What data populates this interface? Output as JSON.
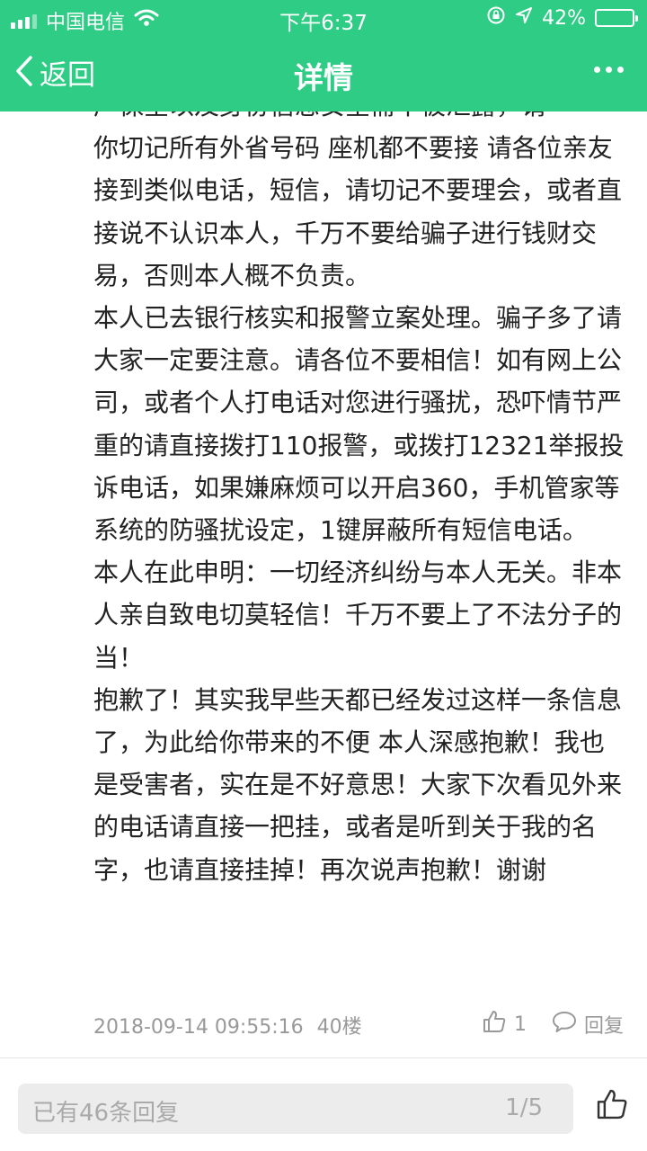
{
  "status_bar": {
    "carrier": "中国电信",
    "time": "下午6:37",
    "battery_percent": "42%",
    "battery_level": 0.42
  },
  "nav": {
    "back_label": "返回",
    "title": "详情"
  },
  "post": {
    "partial_first_line": "产保全以及身份信息安全需不被泄露，请",
    "paragraphs": [
      "你切记所有外省号码 座机都不要接 请各位亲友接到类似电话，短信，请切记不要理会，或者直接说不认识本人，千万不要给骗子进行钱财交易，否则本人概不负责。",
      "本人已去银行核实和报警立案处理。骗子多了请大家一定要注意。请各位不要相信！如有网上公司，或者个人打电话对您进行骚扰，恐吓情节严重的请直接拨打110报警，或拨打12321举报投诉电话，如果嫌麻烦可以开启360，手机管家等系统的防骚扰设定，1键屏蔽所有短信电话。",
      "本人在此申明：一切经济纠纷与本人无关。非本人亲自致电切莫轻信！千万不要上了不法分子的当！",
      "抱歉了！其实我早些天都已经发过这样一条信息了，为此给你带来的不便 本人深感抱歉！我也是受害者，实在是不好意思！大家下次看见外来的电话请直接一把挂，或者是听到关于我的名字，也请直接挂掉！再次说声抱歉！谢谢"
    ],
    "timestamp": "2018-09-14 09:55:16",
    "floor": "40楼",
    "like_count": "1",
    "reply_label": "回复"
  },
  "bottom_bar": {
    "reply_count_text": "已有46条回复",
    "page_indicator": "1/5"
  },
  "colors": {
    "brand_green": "#2ecc85",
    "text": "#222222",
    "meta": "#999999",
    "reply_box": "#ececec"
  },
  "icons": [
    "signal-icon",
    "wifi-icon",
    "lock-rotation-icon",
    "location-icon",
    "battery-icon",
    "back-chevron-icon",
    "more-icon",
    "thumbs-up-icon",
    "comment-icon"
  ]
}
